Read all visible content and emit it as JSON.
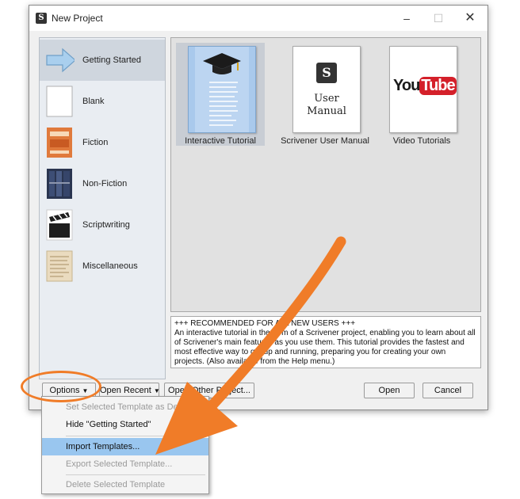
{
  "window": {
    "title": "New Project",
    "minimize_glyph": "–",
    "maximize_glyph": "☐",
    "close_glyph": "✕"
  },
  "sidebar": {
    "items": [
      {
        "label": "Getting Started",
        "icon": "arrow-icon",
        "selected": true
      },
      {
        "label": "Blank",
        "icon": "blank-page-icon"
      },
      {
        "label": "Fiction",
        "icon": "fiction-book-icon"
      },
      {
        "label": "Non-Fiction",
        "icon": "bookshelf-icon"
      },
      {
        "label": "Scriptwriting",
        "icon": "clapperboard-icon"
      },
      {
        "label": "Miscellaneous",
        "icon": "parchment-icon"
      }
    ]
  },
  "templates": [
    {
      "label": "Interactive Tutorial",
      "icon": "graduation-cap-icon",
      "selected": true
    },
    {
      "label": "Scrivener User Manual",
      "logo_letter": "S",
      "line1": "User",
      "line2": "Manual"
    },
    {
      "label": "Video Tutorials",
      "logo_you": "You",
      "logo_tube": "Tube"
    }
  ],
  "description": {
    "line1": "+++ RECOMMENDED FOR ALL NEW USERS +++",
    "body": "An interactive tutorial in the form of a Scrivener project, enabling you to learn about all of Scrivener's main features as you use them. This tutorial provides the fastest and most effective way to get up and running, preparing you for creating your own projects. (Also available from the Help menu.)"
  },
  "buttons": {
    "options": "Options",
    "open_recent": "Open Recent",
    "open_other": "Open Other Project...",
    "open": "Open",
    "cancel": "Cancel",
    "caret": "▼"
  },
  "menu": {
    "items": [
      {
        "label": "Set Selected Template as Default",
        "enabled": false
      },
      {
        "label": "Hide \"Getting Started\"",
        "enabled": true
      },
      {
        "label": "Import Templates...",
        "enabled": true,
        "highlighted": true
      },
      {
        "label": "Export Selected Template...",
        "enabled": false
      },
      {
        "label": "Delete Selected Template",
        "enabled": false
      }
    ]
  },
  "colors": {
    "annotation_orange": "#f07c28",
    "menu_highlight": "#99c6ef",
    "selection": "#cfd6de"
  }
}
